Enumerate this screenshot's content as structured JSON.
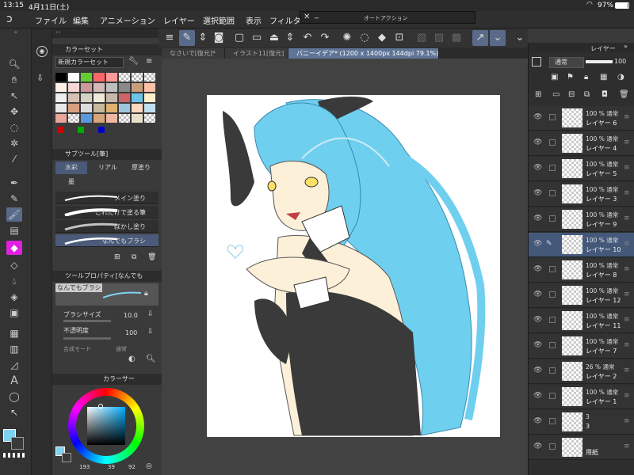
{
  "status": {
    "time": "13:15",
    "date": "4月11日(土)",
    "battery": "97%"
  },
  "menu": [
    "ファイル",
    "編集",
    "アニメーション",
    "レイヤー",
    "選択範囲",
    "表示",
    "フィルタ"
  ],
  "auto_action": {
    "title": "オートアクション"
  },
  "tabs": [
    {
      "label": "なさいで[復元]*"
    },
    {
      "label": "イラスト11[復元]"
    },
    {
      "label": "バニーイデア* (1200 x 1400px 144dpi 79.1%)"
    }
  ],
  "color_set": {
    "title": "カラーセット",
    "selected": "新規カラーセット",
    "swatches": [
      "#000000",
      "#ffffff",
      "#66cc33",
      "#ff6666",
      "#ff9999",
      "checker",
      "checker",
      "checker",
      "#fff0e6",
      "#f6d6d6",
      "#cc9999",
      "#d4b8b8",
      "#bfbfbf",
      "#8a8a8a",
      "#c89f7a",
      "#ffc0a8",
      "#eeeeee",
      "#d6c3b4",
      "#d4d4c4",
      "#f0e8d8",
      "#c8b8a8",
      "#cc6666",
      "#6cc4e8",
      "#fff0cc",
      "#e8e8e8",
      "#d9a07f",
      "#dddddd",
      "#c8b89c",
      "#e0b070",
      "#9fc4e0",
      "#ffd8c0",
      "#c0e0f0",
      "#e8a598",
      "checker",
      "#5a9adc",
      "#d6a57a",
      "#f0b8a0",
      "checker",
      "#e8e0c8",
      "checker"
    ]
  },
  "subtool": {
    "title": "サブツール[筆]",
    "tabs": [
      "水彩",
      "リアル",
      "厚塗り",
      "墨"
    ],
    "brushes": [
      "メイン塗り",
      "これだけで塗る筆",
      "ぼかし塗り",
      "なんでもブラシ"
    ]
  },
  "tool_property": {
    "title": "ツールプロパティ[なんでも",
    "preview_label": "なんでもブラシ",
    "brush_size_label": "ブラシサイズ",
    "brush_size": "10.0",
    "opacity_label": "不透明度",
    "opacity": "100",
    "blend_label": "合成モード",
    "blend": "通常"
  },
  "color_circle": {
    "title": "カラーサー",
    "h": "193",
    "s": "39",
    "v": "92",
    "main_color": "#7fd3f0"
  },
  "layer_panel": {
    "title": "レイヤー",
    "blend": "通常",
    "opacity": "100",
    "layers": [
      {
        "mode": "100 % 通常",
        "name": "レイヤー 6",
        "selected": false
      },
      {
        "mode": "100 % 通常",
        "name": "レイヤー 4",
        "selected": false
      },
      {
        "mode": "100 % 通常",
        "name": "レイヤー 5",
        "selected": false
      },
      {
        "mode": "100 % 通常",
        "name": "レイヤー 3",
        "selected": false
      },
      {
        "mode": "100 % 通常",
        "name": "レイヤー 9",
        "selected": false
      },
      {
        "mode": "100 % 通常",
        "name": "レイヤー 10",
        "selected": true
      },
      {
        "mode": "100 % 通常",
        "name": "レイヤー 8",
        "selected": false
      },
      {
        "mode": "100 % 通常",
        "name": "レイヤー 12",
        "selected": false
      },
      {
        "mode": "100 % 通常",
        "name": "レイヤー 11",
        "selected": false
      },
      {
        "mode": "100 % 通常",
        "name": "レイヤー 7",
        "selected": false
      },
      {
        "mode": "26 % 通常",
        "name": "レイヤー 2",
        "selected": false
      },
      {
        "mode": "100 % 通常",
        "name": "レイヤー 1",
        "selected": false
      },
      {
        "mode": "3",
        "name": "3",
        "selected": false
      },
      {
        "mode": "",
        "name": "用紙",
        "selected": false
      }
    ]
  }
}
